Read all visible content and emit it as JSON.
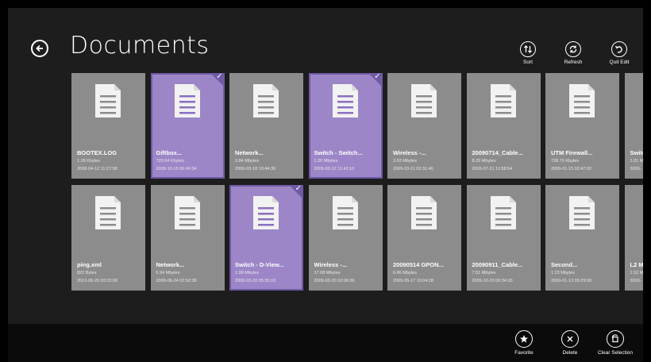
{
  "page_title": "Documents",
  "commands": [
    {
      "label": "Sort",
      "icon": "sort-icon"
    },
    {
      "label": "Refresh",
      "icon": "refresh-icon"
    },
    {
      "label": "Quit Edit",
      "icon": "quit-edit-icon"
    }
  ],
  "files": [
    {
      "name": "BOOTEX.LOG",
      "size": "1.28 Kbytes",
      "date": "2008-04-12 11:27:58",
      "selected": false
    },
    {
      "name": "Giftbox...",
      "size": "720.04 Kbytes",
      "date": "2009-10-15 06:40:34",
      "selected": true
    },
    {
      "name": "Network...",
      "size": "3.84 Mbytes",
      "date": "2009-03-18 10:44:30",
      "selected": false
    },
    {
      "name": "Switch - Switch...",
      "size": "1.20 Mbytes",
      "date": "2009-03-12 11:42:10",
      "selected": true
    },
    {
      "name": "Wireless -...",
      "size": "3.63 Mbytes",
      "date": "2009-03-11 02:31:46",
      "selected": false
    },
    {
      "name": "20090714_Cable...",
      "size": "8.29 Mbytes",
      "date": "2009-07-31 11:58:54",
      "selected": false
    },
    {
      "name": "UTM Firewall...",
      "size": "728.70 Kbytes",
      "date": "2009-01-15 02:47:02",
      "selected": false
    },
    {
      "name": "Switc",
      "size": "1.01 M",
      "date": "2009-",
      "selected": false
    },
    {
      "name": "ping.xml",
      "size": "822 Bytes",
      "date": "2013-06-26 03:22:00",
      "selected": false
    },
    {
      "name": "Network...",
      "size": "6.94 Mbytes",
      "date": "2009-06-24 02:52:38",
      "selected": false
    },
    {
      "name": "Switch - D-View...",
      "size": "1.99 Mbytes",
      "date": "2009-03-20 05:35:10",
      "selected": true
    },
    {
      "name": "Wireless -...",
      "size": "17.08 Mbytes",
      "date": "2009-03-20 02:06:36",
      "selected": false
    },
    {
      "name": "20090514 GPON...",
      "size": "6.86 Mbytes",
      "date": "2009-05-17 10:04:28",
      "selected": false
    },
    {
      "name": "20090911_Cable...",
      "size": "7.51 Mbytes",
      "date": "2009-10-20 06:34:20",
      "selected": false
    },
    {
      "name": "Second...",
      "size": "1.23 Mbytes",
      "date": "2009-01-13 05:29:00",
      "selected": false
    },
    {
      "name": "L2 M",
      "size": "1.52 M",
      "date": "2009-",
      "selected": false
    }
  ],
  "appbar": [
    {
      "label": "Favorite",
      "icon": "star-icon"
    },
    {
      "label": "Delete",
      "icon": "delete-icon"
    },
    {
      "label": "Clear Selection",
      "icon": "clear-selection-icon"
    }
  ],
  "colors": {
    "background": "#1d1d1d",
    "tile": "#8c8c8c",
    "tile_selected": "#9c86c7",
    "selection_border": "#6f5aa6",
    "appbar": "#0b0b0b"
  }
}
